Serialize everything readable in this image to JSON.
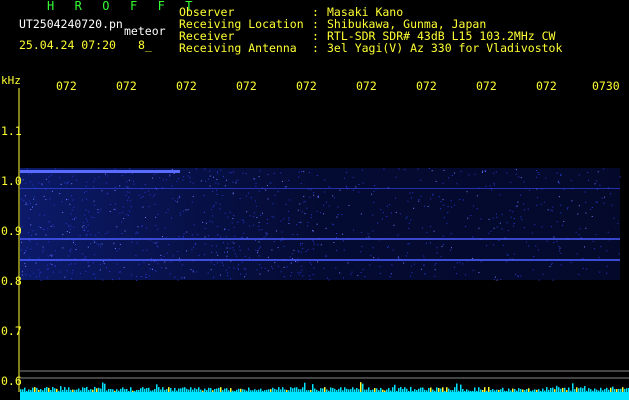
{
  "header": {
    "brand": "H R O F F T",
    "filename": "UT2504240720.pn",
    "tag": "meteor",
    "date": "25.04.24 07:20",
    "count": "8_"
  },
  "station_info": [
    {
      "label": "Observer",
      "sep": ":",
      "value": "Masaki Kano"
    },
    {
      "label": "Receiving Location",
      "sep": ":",
      "value": "Shibukawa, Gunma, Japan"
    },
    {
      "label": "Receiver",
      "sep": ":",
      "value": "RTL-SDR SDR# 43dB L15 103.2MHz CW"
    },
    {
      "label": "Receiving Antenna",
      "sep": ":",
      "value": "3el Yagi(V) Az 330 for Vladivostok"
    }
  ],
  "axis": {
    "y_unit": "kHz",
    "y_ticks": [
      "1.1",
      "1.0",
      "0.9",
      "0.8",
      "0.7",
      "0.6"
    ],
    "x_ticks": [
      "072",
      "072",
      "072",
      "072",
      "072",
      "072",
      "072",
      "072",
      "072",
      "0730"
    ]
  },
  "colors": {
    "label_yellow": "#ffff33",
    "brand_green": "#33ff33",
    "signal_blue": "#2a3cff",
    "baseline_cyan": "#00e5ff"
  }
}
